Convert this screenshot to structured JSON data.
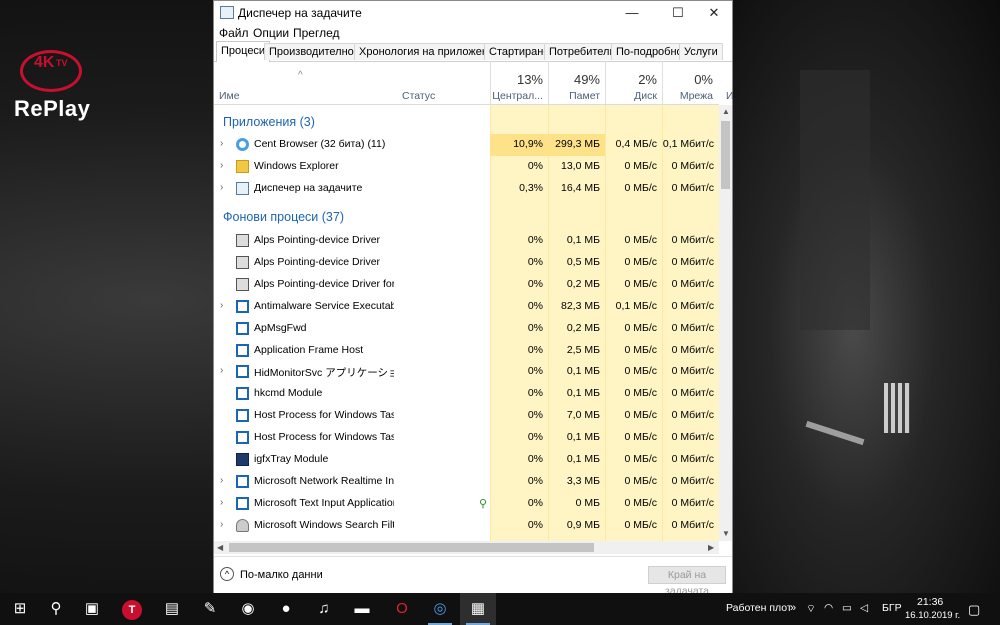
{
  "window": {
    "title": "Диспечер на задачите",
    "controls": {
      "minimize": "—",
      "maximize": "☐",
      "close": "✕"
    }
  },
  "menu": [
    "Файл",
    "Опции",
    "Преглед"
  ],
  "tabs": [
    "Процеси",
    "Производителност",
    "Хронология на приложение",
    "Стартиране",
    "Потребители",
    "По-подробно",
    "Услуги"
  ],
  "columns": {
    "name": "Име",
    "status": "Статус",
    "cpu": {
      "pct": "13%",
      "label": "Централ..."
    },
    "memory": {
      "pct": "49%",
      "label": "Памет"
    },
    "disk": {
      "pct": "2%",
      "label": "Диск"
    },
    "network": {
      "pct": "0%",
      "label": "Мрежа"
    },
    "extra": "И"
  },
  "groups": {
    "apps": "Приложения (3)",
    "background": "Фонови процеси (37)"
  },
  "app_rows": [
    {
      "name": "Cent Browser (32 бита) (11)",
      "cpu": "10,9%",
      "mem": "299,3 МБ",
      "disk": "0,4 МБ/с",
      "net": "0,1 Мбит/с",
      "icon": "cent-browser-icon"
    },
    {
      "name": "Windows Explorer",
      "cpu": "0%",
      "mem": "13,0 МБ",
      "disk": "0 МБ/с",
      "net": "0 Мбит/с",
      "icon": "folder-icon"
    },
    {
      "name": "Диспечер на задачите",
      "cpu": "0,3%",
      "mem": "16,4 МБ",
      "disk": "0 МБ/с",
      "net": "0 Мбит/с",
      "icon": "task-manager-icon"
    }
  ],
  "bg_rows": [
    {
      "name": "Alps Pointing-device Driver",
      "cpu": "0%",
      "mem": "0,1 МБ",
      "disk": "0 МБ/с",
      "net": "0 Мбит/с",
      "icon": "alps-icon"
    },
    {
      "name": "Alps Pointing-device Driver",
      "cpu": "0%",
      "mem": "0,5 МБ",
      "disk": "0 МБ/с",
      "net": "0 Мбит/с",
      "icon": "alps-icon"
    },
    {
      "name": "Alps Pointing-device Driver for ...",
      "cpu": "0%",
      "mem": "0,2 МБ",
      "disk": "0 МБ/с",
      "net": "0 Мбит/с",
      "icon": "alps-icon"
    },
    {
      "name": "Antimalware Service Executable",
      "cpu": "0%",
      "mem": "82,3 МБ",
      "disk": "0,1 МБ/с",
      "net": "0 Мбит/с",
      "icon": "process-icon"
    },
    {
      "name": "ApMsgFwd",
      "cpu": "0%",
      "mem": "0,2 МБ",
      "disk": "0 МБ/с",
      "net": "0 Мбит/с",
      "icon": "process-icon"
    },
    {
      "name": "Application Frame Host",
      "cpu": "0%",
      "mem": "2,5 МБ",
      "disk": "0 МБ/с",
      "net": "0 Мбит/с",
      "icon": "process-icon"
    },
    {
      "name": "HidMonitorSvc アプリケーション",
      "cpu": "0%",
      "mem": "0,1 МБ",
      "disk": "0 МБ/с",
      "net": "0 Мбит/с",
      "icon": "process-icon"
    },
    {
      "name": "hkcmd Module",
      "cpu": "0%",
      "mem": "0,1 МБ",
      "disk": "0 МБ/с",
      "net": "0 Мбит/с",
      "icon": "process-icon"
    },
    {
      "name": "Host Process for Windows Tasks",
      "cpu": "0%",
      "mem": "7,0 МБ",
      "disk": "0 МБ/с",
      "net": "0 Мбит/с",
      "icon": "process-icon"
    },
    {
      "name": "Host Process for Windows Tasks",
      "cpu": "0%",
      "mem": "0,1 МБ",
      "disk": "0 МБ/с",
      "net": "0 Мбит/с",
      "icon": "process-icon"
    },
    {
      "name": "igfxTray Module",
      "cpu": "0%",
      "mem": "0,1 МБ",
      "disk": "0 МБ/с",
      "net": "0 Мбит/с",
      "icon": "intel-icon"
    },
    {
      "name": "Microsoft Network Realtime Ins...",
      "cpu": "0%",
      "mem": "3,3 МБ",
      "disk": "0 МБ/с",
      "net": "0 Мбит/с",
      "icon": "process-icon"
    },
    {
      "name": "Microsoft Text Input Application",
      "cpu": "0%",
      "mem": "0 МБ",
      "disk": "0 МБ/с",
      "net": "0 Мбит/с",
      "icon": "process-icon"
    },
    {
      "name": "Microsoft Windows Search Filte...",
      "cpu": "0%",
      "mem": "0,9 МБ",
      "disk": "0 МБ/с",
      "net": "0 Мбит/с",
      "icon": "search-indexer-icon"
    }
  ],
  "footer": {
    "fewer_details": "По-малко данни",
    "end_task": "Край на задачата"
  },
  "taskbar": {
    "desktop_label": "Работен плот",
    "language": "БГР",
    "time": "21:36",
    "date": "16.10.2019 г."
  },
  "overlay": {
    "logo_4k": "4K",
    "logo_tv": "TV",
    "logo_replay": "RePlay"
  }
}
